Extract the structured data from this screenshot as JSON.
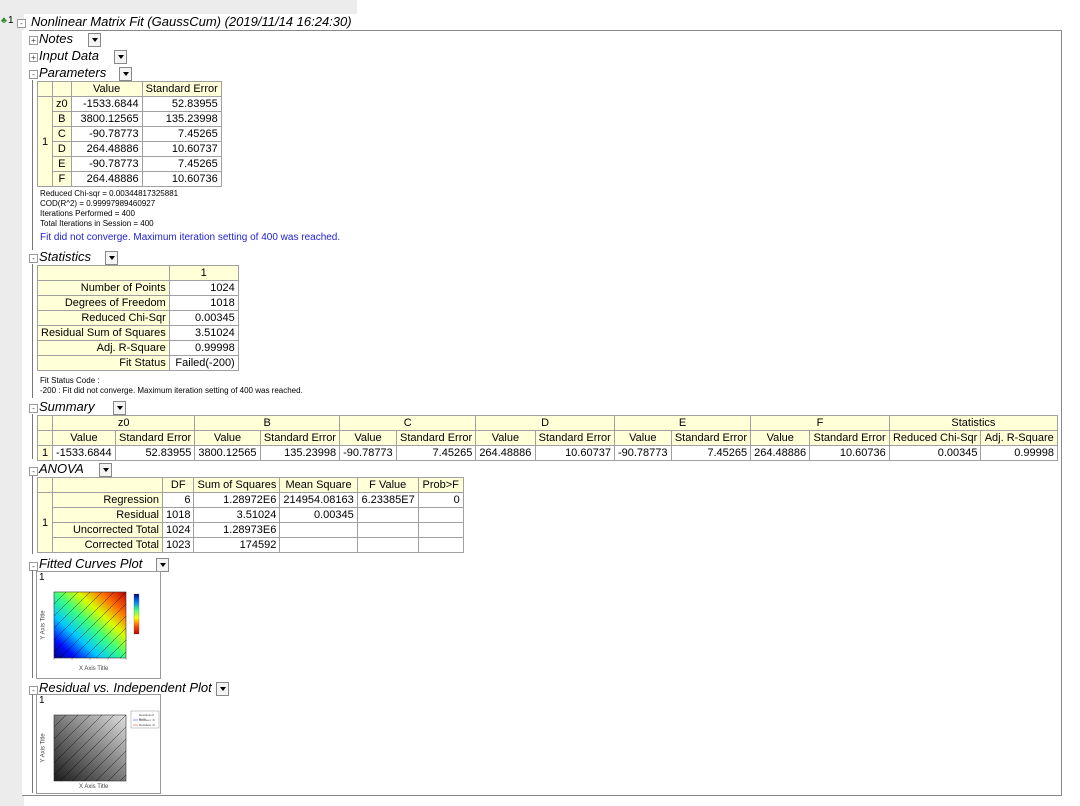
{
  "report": {
    "node_index": "1",
    "title": "Nonlinear Matrix Fit (GaussCum) (2019/11/14 16:24:30)"
  },
  "sections": {
    "notes": "Notes",
    "input_data": "Input Data",
    "parameters": "Parameters",
    "statistics": "Statistics",
    "summary": "Summary",
    "anova": "ANOVA",
    "fitted_curves": "Fitted Curves Plot",
    "residual_plot": "Residual vs. Independent Plot"
  },
  "parameters": {
    "headers": [
      "Value",
      "Standard Error"
    ],
    "row_index": "1",
    "rows": [
      {
        "name": "z0",
        "value": "-1533.6844",
        "se": "52.83955"
      },
      {
        "name": "B",
        "value": "3800.12565",
        "se": "135.23998"
      },
      {
        "name": "C",
        "value": "-90.78773",
        "se": "7.45265"
      },
      {
        "name": "D",
        "value": "264.48886",
        "se": "10.60737"
      },
      {
        "name": "E",
        "value": "-90.78773",
        "se": "7.45265"
      },
      {
        "name": "F",
        "value": "264.48886",
        "se": "10.60736"
      }
    ],
    "notes": [
      "Reduced Chi-sqr = 0.00344817325881",
      "COD(R^2) = 0.99997989460927",
      "Iterations Performed = 400",
      "Total Iterations in Session = 400"
    ],
    "warning": "Fit did not converge. Maximum iteration setting of 400 was reached."
  },
  "statistics": {
    "col_header": "1",
    "rows": [
      {
        "label": "Number of Points",
        "value": "1024"
      },
      {
        "label": "Degrees of Freedom",
        "value": "1018"
      },
      {
        "label": "Reduced Chi-Sqr",
        "value": "0.00345"
      },
      {
        "label": "Residual Sum of Squares",
        "value": "3.51024"
      },
      {
        "label": "Adj. R-Square",
        "value": "0.99998"
      },
      {
        "label": "Fit Status",
        "value": "Failed(-200)"
      }
    ],
    "code_title": "Fit Status Code :",
    "code_line": "-200 : Fit did not converge. Maximum iteration setting of 400 was reached."
  },
  "summary": {
    "groups": [
      "z0",
      "B",
      "C",
      "D",
      "E",
      "F",
      "Statistics"
    ],
    "subheaders": [
      "Value",
      "Standard Error",
      "Value",
      "Standard Error",
      "Value",
      "Standard Error",
      "Value",
      "Standard Error",
      "Value",
      "Standard Error",
      "Value",
      "Standard Error",
      "Reduced Chi-Sqr",
      "Adj. R-Square"
    ],
    "row_index": "1",
    "values": [
      "-1533.6844",
      "52.83955",
      "3800.12565",
      "135.23998",
      "-90.78773",
      "7.45265",
      "264.48886",
      "10.60737",
      "-90.78773",
      "7.45265",
      "264.48886",
      "10.60736",
      "0.00345",
      "0.99998"
    ]
  },
  "anova": {
    "headers": [
      "DF",
      "Sum of Squares",
      "Mean Square",
      "F Value",
      "Prob>F"
    ],
    "row_index": "1",
    "rows": [
      {
        "label": "Regression",
        "df": "6",
        "ss": "1.28972E6",
        "ms": "214954.08163",
        "f": "6.23385E7",
        "p": "0"
      },
      {
        "label": "Residual",
        "df": "1018",
        "ss": "3.51024",
        "ms": "0.00345",
        "f": "",
        "p": ""
      },
      {
        "label": "Uncorrected Total",
        "df": "1024",
        "ss": "1.28973E6",
        "ms": "",
        "f": "",
        "p": ""
      },
      {
        "label": "Corrected Total",
        "df": "1023",
        "ss": "174592",
        "ms": "",
        "f": "",
        "p": ""
      }
    ]
  },
  "plots": {
    "fitted_index": "1",
    "fitted_xlabel": "X Axis Title",
    "fitted_ylabel": "Y Axis Title",
    "residual_index": "1",
    "residual_xlabel": "X Axis Title",
    "residual_ylabel": "Y Axis Title",
    "residual_legend": [
      "Residual of Conv",
      "Between: Xi",
      "Residual: Xi"
    ]
  },
  "colors": {
    "header_bg": "#ffffd8",
    "warning_text": "#1f1fd6",
    "side_panel": "#ececec"
  }
}
